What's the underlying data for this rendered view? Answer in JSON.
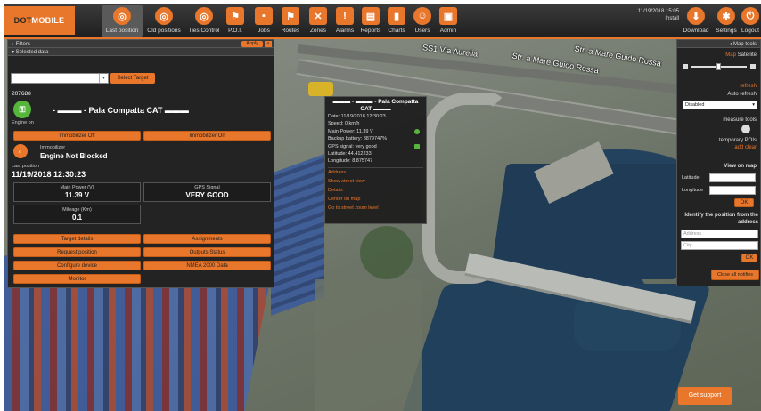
{
  "brand": {
    "logo_a": "DOT",
    "logo_b": "MOBILE"
  },
  "nav": [
    {
      "label": "Last position",
      "icon": "globe-icon",
      "glyph": "◎"
    },
    {
      "label": "Old positions",
      "icon": "history-icon",
      "glyph": "◎"
    },
    {
      "label": "Ties Control",
      "icon": "route-icon",
      "glyph": "◎"
    },
    {
      "label": "P.O.I.",
      "icon": "flag-icon",
      "glyph": "⚑"
    },
    {
      "label": "Jobs",
      "icon": "briefcase-icon",
      "glyph": "▪"
    },
    {
      "label": "Routes",
      "icon": "route-flag-icon",
      "glyph": "⚑"
    },
    {
      "label": "Zones",
      "icon": "zones-icon",
      "glyph": "✕"
    },
    {
      "label": "Alarms",
      "icon": "alarm-icon",
      "glyph": "!"
    },
    {
      "label": "Reports",
      "icon": "report-icon",
      "glyph": "▤"
    },
    {
      "label": "Charts",
      "icon": "chart-icon",
      "glyph": "▮"
    },
    {
      "label": "Users",
      "icon": "users-icon",
      "glyph": "☺"
    },
    {
      "label": "Admin",
      "icon": "admin-icon",
      "glyph": "▣"
    }
  ],
  "clock": {
    "date": "11/19/2018 15:05",
    "sub": "Install"
  },
  "right_nav": [
    {
      "label": "Download",
      "icon": "download-icon",
      "glyph": "⬇"
    },
    {
      "label": "Settings",
      "icon": "settings-icon",
      "glyph": "✱"
    },
    {
      "label": "Logout",
      "icon": "logout-icon",
      "glyph": "⏻"
    }
  ],
  "left_panel": {
    "filters_label": "▸ Filters",
    "apply_label": "Apply",
    "close_label": "«",
    "selected_label": "▾ Selected data",
    "select_target_label": "Select Target",
    "target_id": "207688",
    "engine_on": "Engine on",
    "target_name": "- ▬▬▬ - Pala Compatta CAT ▬▬▬",
    "immob_off": "Immobilizer Off",
    "immob_on": "Immobilizer On",
    "immobilizer_label": "Immobilizer",
    "engine_status": "Engine Not Blocked",
    "last_position_label": "Last position",
    "last_position_time": "11/19/2018 12:30:23",
    "main_power_label": "Main Power (V)",
    "main_power_value": "11.39 V",
    "gps_label": "GPS Signal",
    "gps_value": "VERY GOOD",
    "mileage_label": "Mileage (Km)",
    "mileage_value": "0.1",
    "buttons": [
      "Target details",
      "Assignments",
      "Request position",
      "Outputs Status",
      "Configure device",
      "NMEA 2000 Data",
      "Monitor"
    ]
  },
  "popup": {
    "title": "▬▬▬ - ▬▬▬ - Pala Compatta CAT ▬▬▬",
    "rows": [
      "Date: 11/19/2018 12:30:23",
      "Speed: 0 km/h",
      "Main Power: 11.39 V",
      "Backup battery: 8879747%",
      "GPS signal: very good",
      "Latitude: 44.412233",
      "Longitude: 8.875747"
    ],
    "links": [
      "Address",
      "Show street view",
      "Details",
      "Center on map",
      "Go to street zoom level"
    ]
  },
  "map": {
    "labels": [
      "SS1 Via Aurelia",
      "Str. a Mare Guido Rossa",
      "Str. a Mare Guido Rossa"
    ]
  },
  "right_panel": {
    "header": "◂ Map tools",
    "map_label": "Map",
    "satellite_label": "Satellite",
    "refresh_label": "refresh",
    "auto_refresh_label": "Auto refresh",
    "auto_refresh_value": "Disabled",
    "measure_label": "measure tools",
    "temp_pois_label": "temporary POIs",
    "add_clear": "add clear",
    "view_on_map": "View on map",
    "latitude_label": "Latitude",
    "longitude_label": "Longitude",
    "ok1": "OK",
    "identify_label": "Identify the position from the address",
    "address_ph": "Address",
    "city_ph": "City",
    "ok2": "OK",
    "close_notifies": "Close all notifies"
  },
  "support_label": "Get support",
  "colors": {
    "accent": "#e8762b",
    "panel": "#232323",
    "ok": "#56b63c"
  }
}
